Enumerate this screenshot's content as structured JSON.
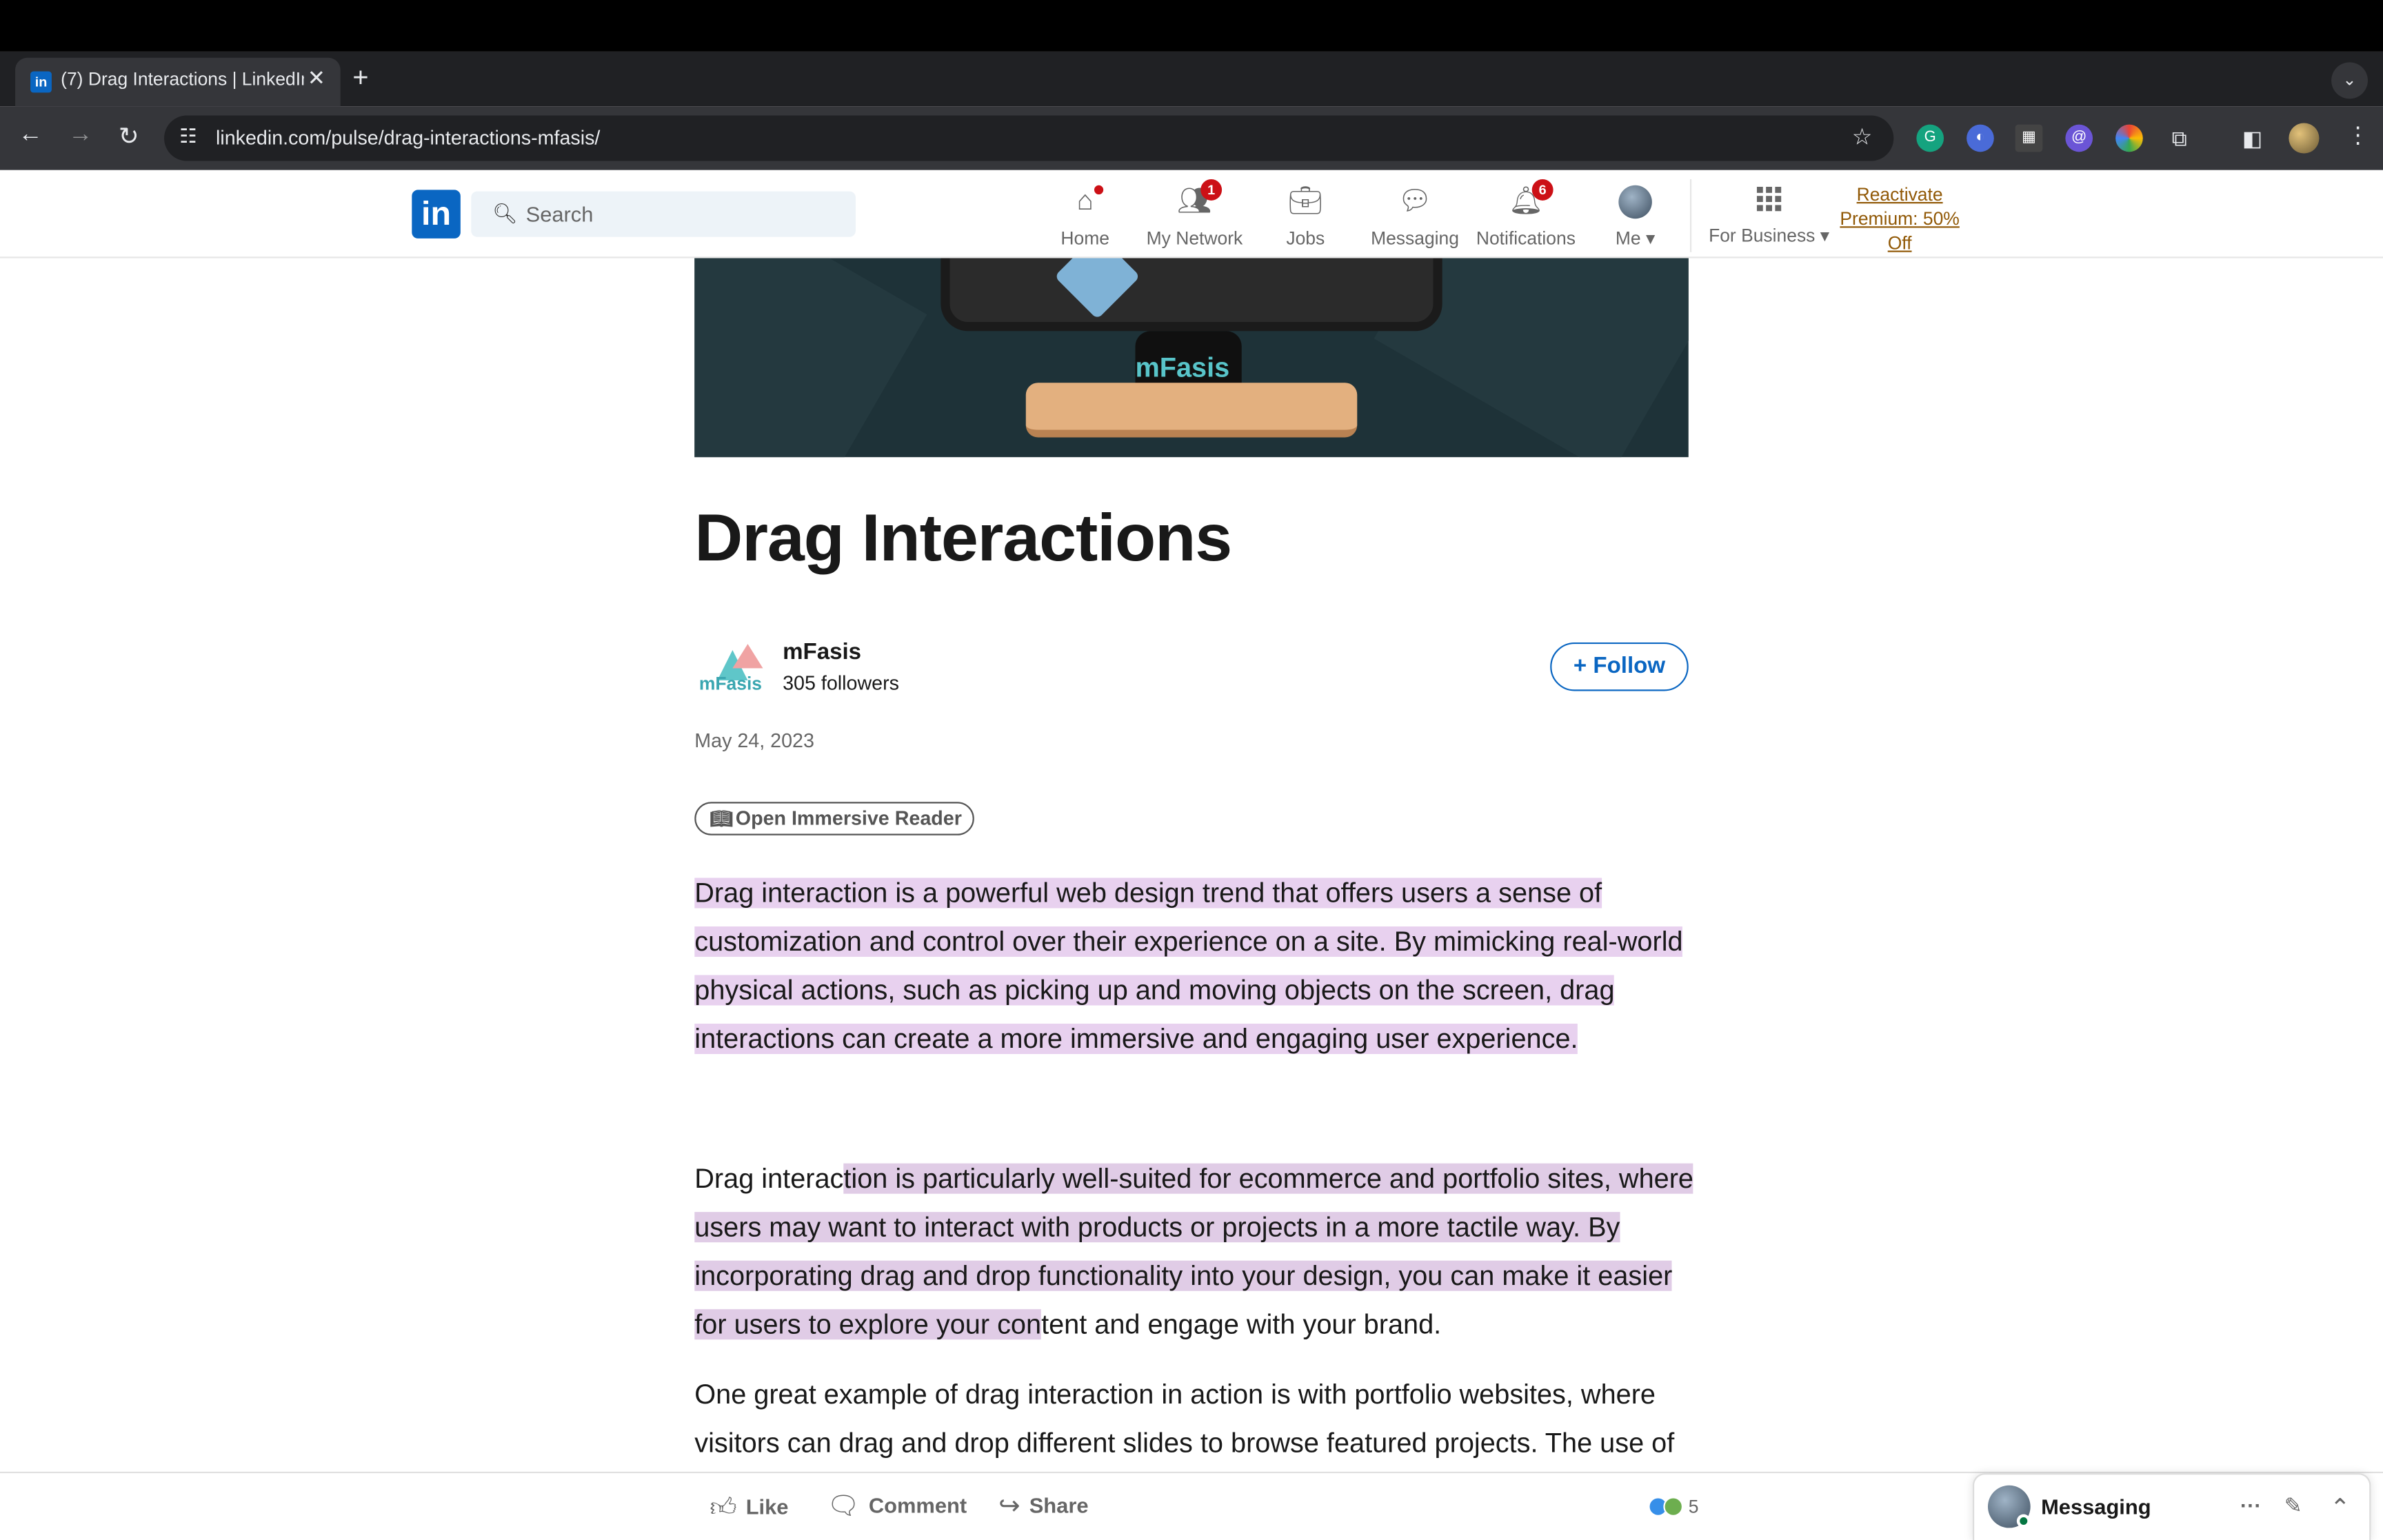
{
  "browser": {
    "tab_title": "(7) Drag Interactions | LinkedIn",
    "tab_close": "✕",
    "new_tab": "+",
    "tab_menu": "⌄",
    "back": "←",
    "forward": "→",
    "reload": "↻",
    "url": "linkedin.com/pulse/drag-interactions-mfasis/",
    "menu": "⋮"
  },
  "linkedin_nav": {
    "logo": "in",
    "search_placeholder": "Search",
    "items": [
      {
        "label": "Home",
        "icon": "home-icon",
        "dot": true
      },
      {
        "label": "My Network",
        "icon": "network-icon",
        "badge": "1"
      },
      {
        "label": "Jobs",
        "icon": "briefcase-icon"
      },
      {
        "label": "Messaging",
        "icon": "chat-icon"
      },
      {
        "label": "Notifications",
        "icon": "bell-icon",
        "badge": "6"
      },
      {
        "label": "Me",
        "icon": "avatar"
      }
    ],
    "for_business": "For Business",
    "premium": "Reactivate Premium: 50% Off"
  },
  "article": {
    "hero_brand": "mFasis",
    "title": "Drag Interactions",
    "author": {
      "name": "mFasis",
      "followers": "305 followers",
      "logo_text": "mFasis"
    },
    "follow_label": "Follow",
    "follow_plus": "+",
    "date": "May 24, 2023",
    "reader_label": "Open Immersive Reader",
    "paragraph1": "Drag interaction is a powerful web design trend that offers users a sense of customization and control over their experience on a site. By mimicking real-world physical actions, such as picking up and moving objects on the screen, drag interactions can create a more immersive and engaging user experience.",
    "paragraph2": {
      "before": "Drag interac",
      "highlighted": "tion is particularly well-suited for ecommerce and portfolio sites, where users may want to interact with products or projects in a more tactile way. By incorporating drag and drop functionality into your design, you can make it easier for users to explore your con",
      "after": "tent and engage with your brand."
    },
    "paragraph3": "One great example of drag interaction in action is with portfolio websites, where visitors can drag and drop different slides to browse featured projects. The use of"
  },
  "bottom_bar": {
    "like": "Like",
    "comment": "Comment",
    "share": "Share",
    "reaction_count": "5"
  },
  "messaging": {
    "label": "Messaging",
    "more": "···",
    "collapse": "⌃"
  },
  "colors": {
    "linkedin_blue": "#0a66c2",
    "badge_red": "#cc1016",
    "highlight": "#e8d1ef",
    "premium_gold": "#915907"
  }
}
